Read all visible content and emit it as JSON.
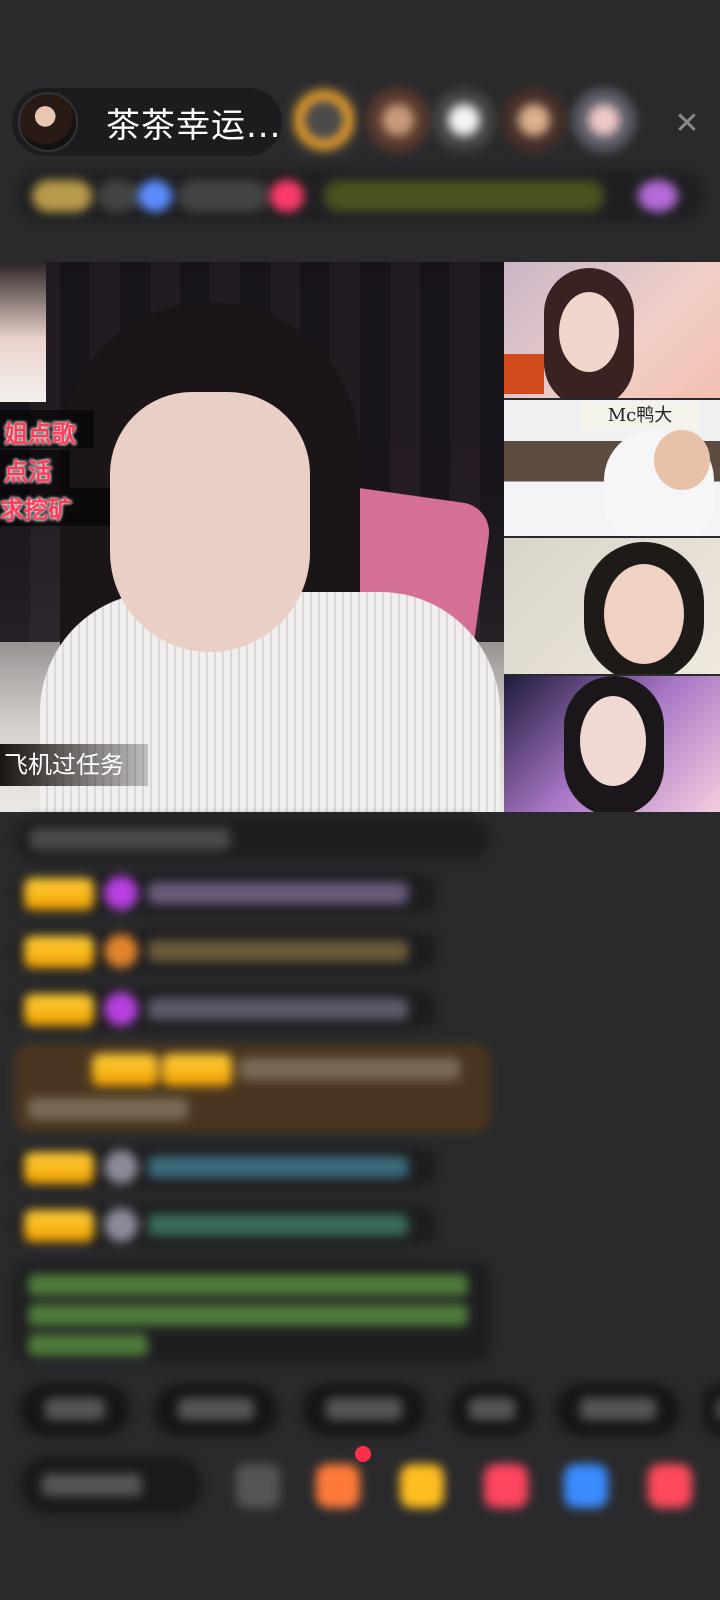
{
  "header": {
    "host_name": "茶茶幸运...",
    "close_icon": "close-icon"
  },
  "video": {
    "overlay_lines": [
      "姐点歌",
      "点活",
      "求挖矿"
    ],
    "bottom_banner": "飞机过任务",
    "side_sign": "Mc鸭大"
  },
  "colors": {
    "background": "#2a2a2c",
    "badge": "#f0a000",
    "overlay_red": "#ff3b57"
  }
}
